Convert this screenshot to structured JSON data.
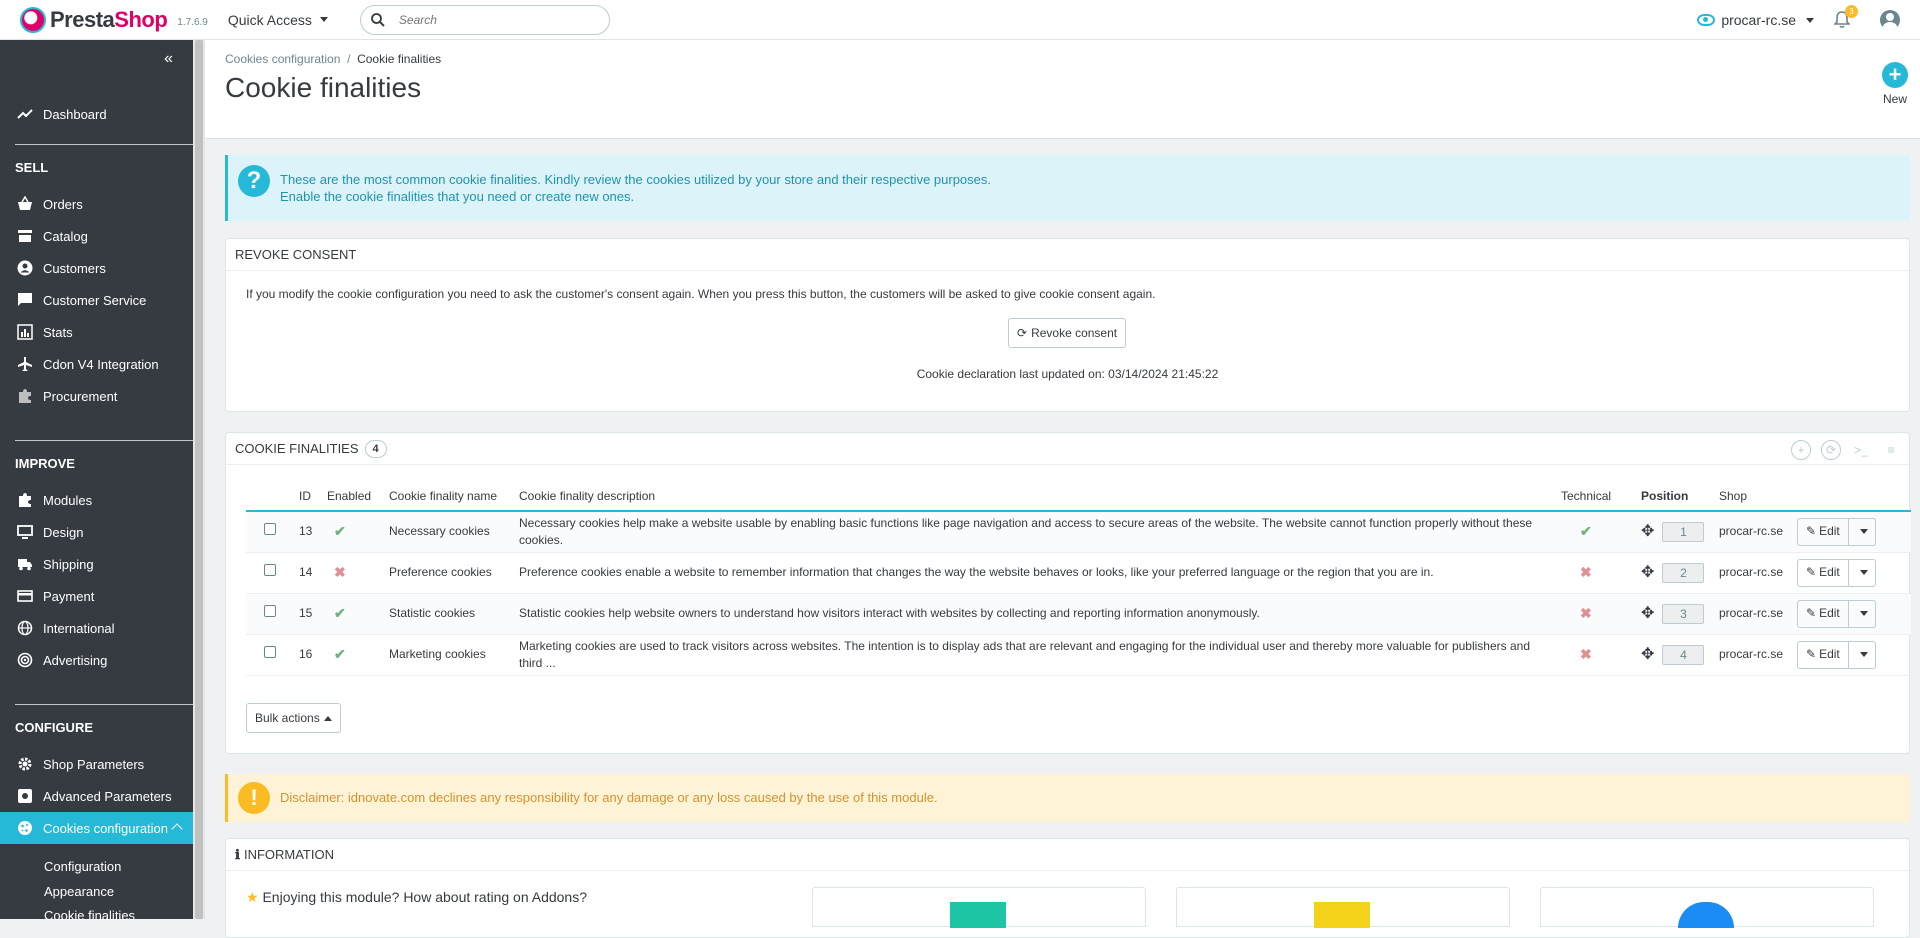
{
  "header": {
    "logo_text_a": "Presta",
    "logo_text_b": "Shop",
    "version": "1.7.6.9",
    "quick_access": "Quick Access",
    "search_placeholder": "Search",
    "shop_name": "procar-rc.se",
    "notif_count": "3"
  },
  "sidebar": {
    "dashboard": "Dashboard",
    "sell": "SELL",
    "sell_items": [
      "Orders",
      "Catalog",
      "Customers",
      "Customer Service",
      "Stats",
      "Cdon V4 Integration",
      "Procurement"
    ],
    "improve": "IMPROVE",
    "improve_items": [
      "Modules",
      "Design",
      "Shipping",
      "Payment",
      "International",
      "Advertising"
    ],
    "configure": "CONFIGURE",
    "configure_items": [
      "Shop Parameters",
      "Advanced Parameters",
      "Cookies configuration"
    ],
    "sub_items": [
      "Configuration",
      "Appearance",
      "Cookie finalities"
    ]
  },
  "page": {
    "breadcrumb_parent": "Cookies configuration",
    "breadcrumb_sep": "/",
    "breadcrumb_current": "Cookie finalities",
    "title": "Cookie finalities",
    "new_label": "New"
  },
  "info_alert": {
    "line1": "These are the most common cookie finalities. Kindly review the cookies utilized by your store and their respective purposes.",
    "line2": "Enable the cookie finalities that you need or create new ones."
  },
  "revoke": {
    "heading": "REVOKE CONSENT",
    "text": "If you modify the cookie configuration you need to ask the customer's consent again. When you press this button, the customers will be asked to give cookie consent again.",
    "button": "Revoke consent",
    "last_updated": "Cookie declaration last updated on: 03/14/2024 21:45:22"
  },
  "finalities": {
    "heading": "COOKIE FINALITIES",
    "count": "4",
    "columns": [
      "ID",
      "Enabled",
      "Cookie finality name",
      "Cookie finality description",
      "Technical",
      "Position",
      "Shop"
    ],
    "rows": [
      {
        "id": "13",
        "enabled": true,
        "name": "Necessary cookies",
        "desc": "Necessary cookies help make a website usable by enabling basic functions like page navigation and access to secure areas of the website. The website cannot function properly without these cookies.",
        "technical": true,
        "position": "1",
        "shop": "procar-rc.se"
      },
      {
        "id": "14",
        "enabled": false,
        "name": "Preference cookies",
        "desc": "Preference cookies enable a website to remember information that changes the way the website behaves or looks, like your preferred language or the region that you are in.",
        "technical": false,
        "position": "2",
        "shop": "procar-rc.se"
      },
      {
        "id": "15",
        "enabled": true,
        "name": "Statistic cookies",
        "desc": "Statistic cookies help website owners to understand how visitors interact with websites by collecting and reporting information anonymously.",
        "technical": false,
        "position": "3",
        "shop": "procar-rc.se"
      },
      {
        "id": "16",
        "enabled": true,
        "name": "Marketing cookies",
        "desc": "Marketing cookies are used to track visitors across websites. The intention is to display ads that are relevant and engaging for the individual user and thereby more valuable for publishers and third ...",
        "technical": false,
        "position": "4",
        "shop": "procar-rc.se"
      }
    ],
    "edit_label": "Edit",
    "bulk_actions": "Bulk actions"
  },
  "disclaimer": "Disclaimer: idnovate.com declines any responsibility for any damage or any loss caused by the use of this module.",
  "information": {
    "heading": "INFORMATION",
    "rate_text": "Enjoying this module? How about rating on Addons?"
  },
  "colors": {
    "primary": "#25b9d7",
    "sidebar_bg": "#363a41",
    "success": "#70b580",
    "danger": "#e08f95",
    "warning": "#fbbb22"
  }
}
